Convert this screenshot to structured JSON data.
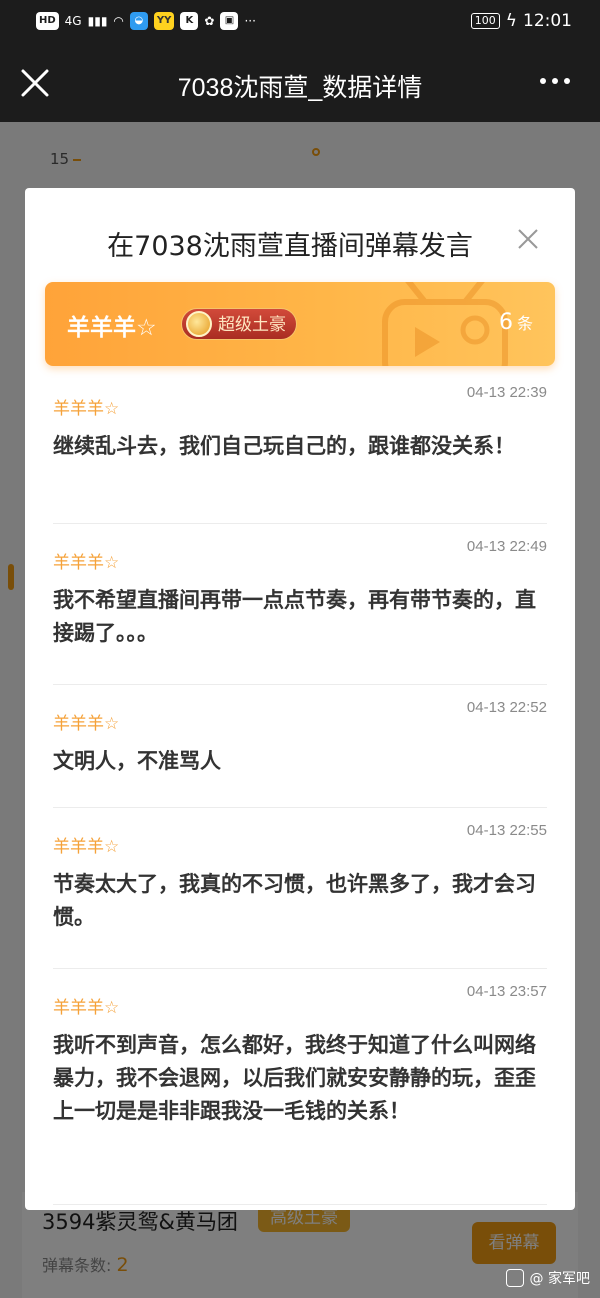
{
  "status_bar": {
    "left_chips": [
      "HD",
      "4G",
      "YY",
      "K"
    ],
    "battery": "100",
    "time": "12:01",
    "overflow": "···"
  },
  "app_bar": {
    "title": "7038沈雨萱_数据详情"
  },
  "background": {
    "axis_value": "15",
    "card": {
      "name": "3594紫灵鸳&黄马团",
      "badge": "高级土豪",
      "count_label": "弹幕条数:",
      "count_value": "2",
      "button": "看弹幕"
    }
  },
  "modal": {
    "title": "在7038沈雨萱直播间弹幕发言",
    "banner": {
      "user": "羊羊羊☆",
      "badge": "超级土豪",
      "count": "6",
      "count_unit": "条"
    },
    "messages": [
      {
        "user": "羊羊羊☆",
        "time": "04-13 22:39",
        "text": "继续乱斗去，我们自己玩自己的，跟谁都没关系！"
      },
      {
        "user": "羊羊羊☆",
        "time": "04-13 22:49",
        "text": "我不希望直播间再带一点点节奏，再有带节奏的，直接踢了。。。"
      },
      {
        "user": "羊羊羊☆",
        "time": "04-13 22:52",
        "text": "文明人，不准骂人"
      },
      {
        "user": "羊羊羊☆",
        "time": "04-13 22:55",
        "text": "节奏太大了，我真的不习惯，也许黑多了，我才会习惯。"
      },
      {
        "user": "羊羊羊☆",
        "time": "04-13 23:57",
        "text": "我听不到声音，怎么都好，我终于知道了什么叫网络暴力，我不会退网，以后我们就安安静静的玩，歪歪上一切是是非非跟我没一毛钱的关系！"
      }
    ]
  },
  "watermark": {
    "text": "@ 家军吧"
  },
  "colors": {
    "accent": "#f39c12",
    "username": "#f5a23a",
    "banner": "#ffa339"
  }
}
